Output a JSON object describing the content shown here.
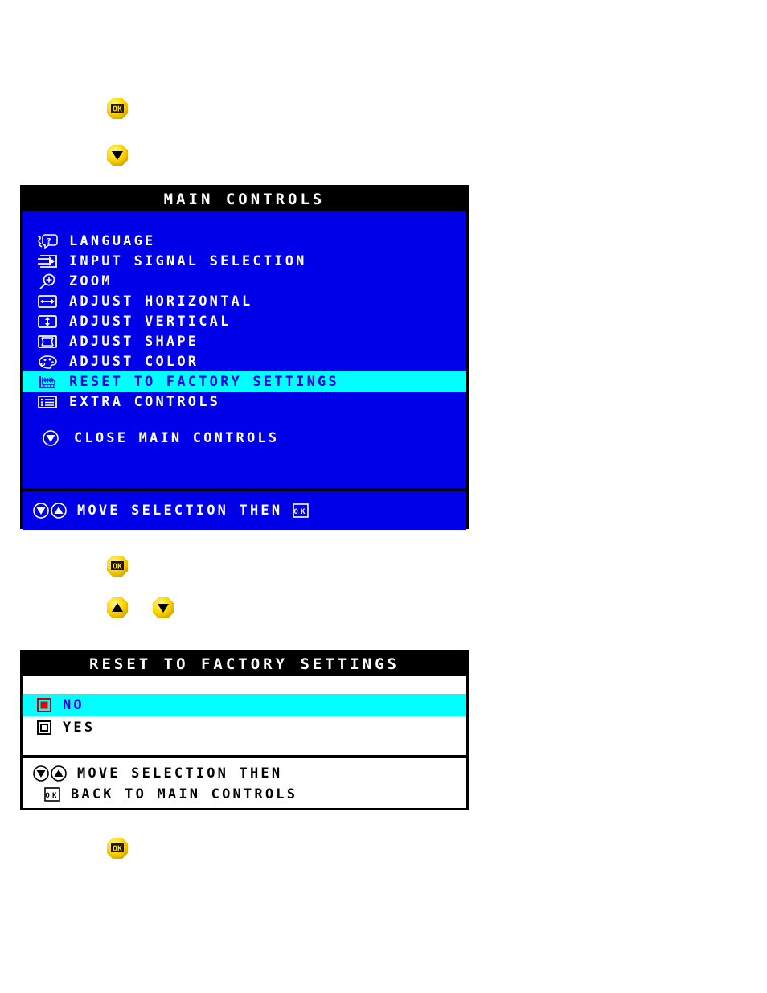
{
  "page": {
    "background": "#ffffff",
    "osd_blue": "#0000e8",
    "osd_highlight": "#00ffff",
    "osd_black": "#000000",
    "osd_white": "#ffffff",
    "button_yellow": "#ffe000"
  },
  "buttons": [
    {
      "id": "ok-top",
      "icon": "ok-button-icon",
      "label": "OK"
    },
    {
      "id": "down-top",
      "icon": "down-arrow-icon",
      "label": "DOWN"
    },
    {
      "id": "ok-middle",
      "icon": "ok-button-icon",
      "label": "OK"
    },
    {
      "id": "up-middle",
      "icon": "up-arrow-icon",
      "label": "UP"
    },
    {
      "id": "down-middle",
      "icon": "down-arrow-icon",
      "label": "DOWN"
    },
    {
      "id": "ok-bottom",
      "icon": "ok-button-icon",
      "label": "OK"
    }
  ],
  "main_controls": {
    "title": "MAIN CONTROLS",
    "items": [
      {
        "icon": "language-icon",
        "label": "LANGUAGE",
        "selected": false
      },
      {
        "icon": "input-signal-icon",
        "label": "INPUT SIGNAL SELECTION",
        "selected": false
      },
      {
        "icon": "zoom-icon",
        "label": "ZOOM",
        "selected": false
      },
      {
        "icon": "adjust-horizontal-icon",
        "label": "ADJUST HORIZONTAL",
        "selected": false
      },
      {
        "icon": "adjust-vertical-icon",
        "label": "ADJUST VERTICAL",
        "selected": false
      },
      {
        "icon": "adjust-shape-icon",
        "label": "ADJUST SHAPE",
        "selected": false
      },
      {
        "icon": "adjust-color-icon",
        "label": "ADJUST COLOR",
        "selected": false
      },
      {
        "icon": "factory-reset-icon",
        "label": "RESET TO FACTORY SETTINGS",
        "selected": true
      },
      {
        "icon": "extra-controls-icon",
        "label": "EXTRA CONTROLS",
        "selected": false
      }
    ],
    "close_item": {
      "icon": "down-arrow-icon",
      "label": "CLOSE MAIN CONTROLS"
    },
    "footer": {
      "label": "MOVE SELECTION THEN",
      "trailing_icon": "ok-button-icon"
    }
  },
  "reset_dialog": {
    "title": "RESET TO FACTORY SETTINGS",
    "options": [
      {
        "label": "NO",
        "selected": true,
        "radio": "radio-selected-icon"
      },
      {
        "label": "YES",
        "selected": false,
        "radio": "radio-unselected-icon"
      }
    ],
    "footer_line1": "MOVE SELECTION THEN",
    "footer_line2": "BACK TO MAIN CONTROLS"
  }
}
